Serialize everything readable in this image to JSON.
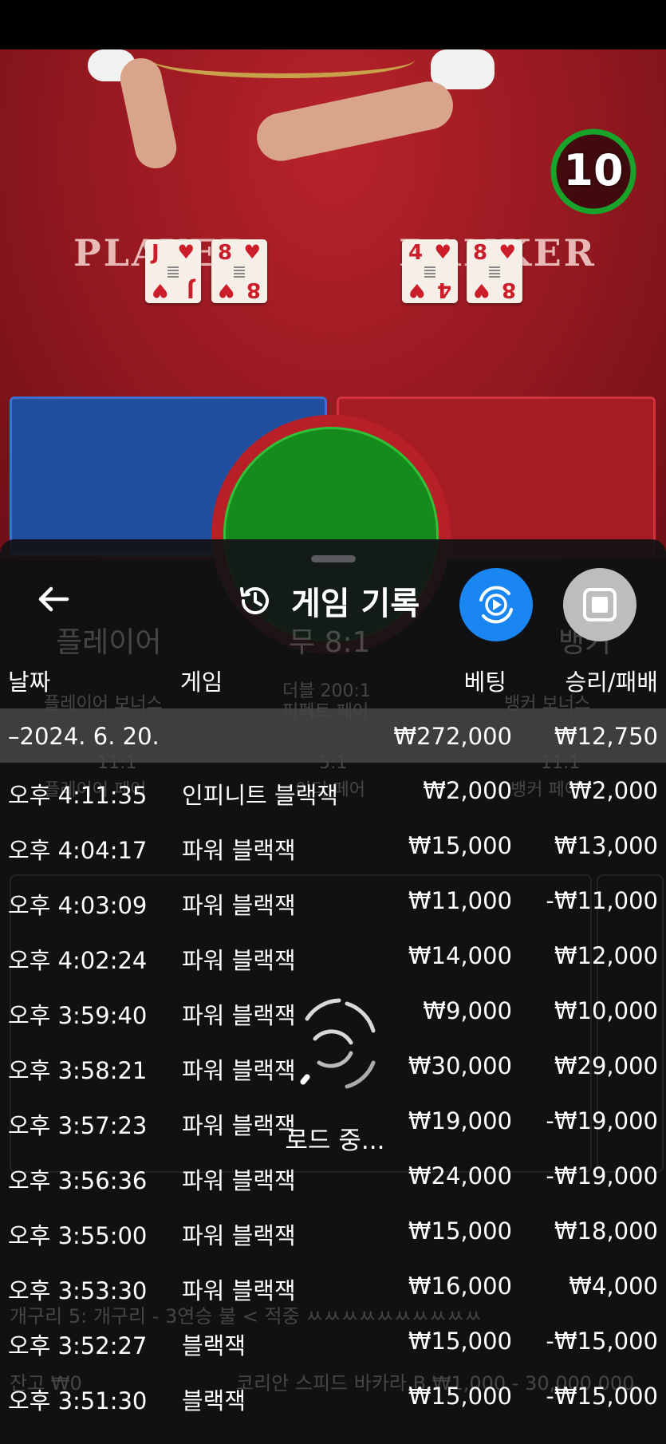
{
  "timer": {
    "value": "10",
    "progress": 1.0
  },
  "table": {
    "player_label": "PLAYER",
    "banker_label": "BANKER",
    "player_cards": [
      {
        "rank": "J",
        "suit": "♥"
      },
      {
        "rank": "8",
        "suit": "♥"
      }
    ],
    "banker_cards": [
      {
        "rank": "4",
        "suit": "♥"
      },
      {
        "rank": "8",
        "suit": "♥"
      }
    ]
  },
  "sheet": {
    "title": "게임 기록",
    "columns": {
      "date": "날짜",
      "game": "게임",
      "bet": "베팅",
      "result": "승리/패배"
    },
    "summary": {
      "date": "–2024. 6. 20.",
      "bet": "₩272,000",
      "result": "₩12,750"
    },
    "rows": [
      {
        "time": "오후 4:11:35",
        "game": "인피니트 블랙잭",
        "bet": "₩2,000",
        "result": "₩2,000"
      },
      {
        "time": "오후 4:04:17",
        "game": "파워 블랙잭",
        "bet": "₩15,000",
        "result": "₩13,000"
      },
      {
        "time": "오후 4:03:09",
        "game": "파워 블랙잭",
        "bet": "₩11,000",
        "result": "-₩11,000"
      },
      {
        "time": "오후 4:02:24",
        "game": "파워 블랙잭",
        "bet": "₩14,000",
        "result": "₩12,000"
      },
      {
        "time": "오후 3:59:40",
        "game": "파워 블랙잭",
        "bet": "₩9,000",
        "result": "₩10,000"
      },
      {
        "time": "오후 3:58:21",
        "game": "파워 블랙잭",
        "bet": "₩30,000",
        "result": "₩29,000"
      },
      {
        "time": "오후 3:57:23",
        "game": "파워 블랙잭",
        "bet": "₩19,000",
        "result": "-₩19,000"
      },
      {
        "time": "오후 3:56:36",
        "game": "파워 블랙잭",
        "bet": "₩24,000",
        "result": "-₩19,000"
      },
      {
        "time": "오후 3:55:00",
        "game": "파워 블랙잭",
        "bet": "₩15,000",
        "result": "₩18,000"
      },
      {
        "time": "오후 3:53:30",
        "game": "파워 블랙잭",
        "bet": "₩16,000",
        "result": "₩4,000"
      },
      {
        "time": "오후 3:52:27",
        "game": "블랙잭",
        "bet": "₩15,000",
        "result": "-₩15,000"
      },
      {
        "time": "오후 3:51:30",
        "game": "블랙잭",
        "bet": "₩15,000",
        "result": "-₩15,000"
      }
    ],
    "loading_text": "로드 중..."
  },
  "background_ghost": {
    "player": "플레이어",
    "tie": "무 8:1",
    "banker": "뱅커",
    "player_bonus": "플레이어 보너스",
    "perfect_pair": "퍼펙트 페어",
    "either_odds": "더블 200:1",
    "banker_bonus": "뱅커 보너스",
    "pp_odds": "11:1",
    "ep_odds": "5:1",
    "bp_odds": "11:1",
    "player_pair": "플레이어 페어",
    "either_pair": "이더 페어",
    "banker_pair": "뱅커 페어",
    "marquee": "개구리 5: 개구리 - 3연승 불 < 적중 ㅆㅆㅆㅆㅆㅆㅆㅆㅆㅆ",
    "balance": "잔고 ₩0",
    "table_limits": "코리안 스피드 바카라 B ₩1,000 - 30,000,000"
  },
  "colors": {
    "felt": "#9a1a22",
    "player_area": "#1f4f9e",
    "tie_area": "#158a1d",
    "replay_button": "#1a86f2",
    "timer_ring": "#18a32a"
  }
}
